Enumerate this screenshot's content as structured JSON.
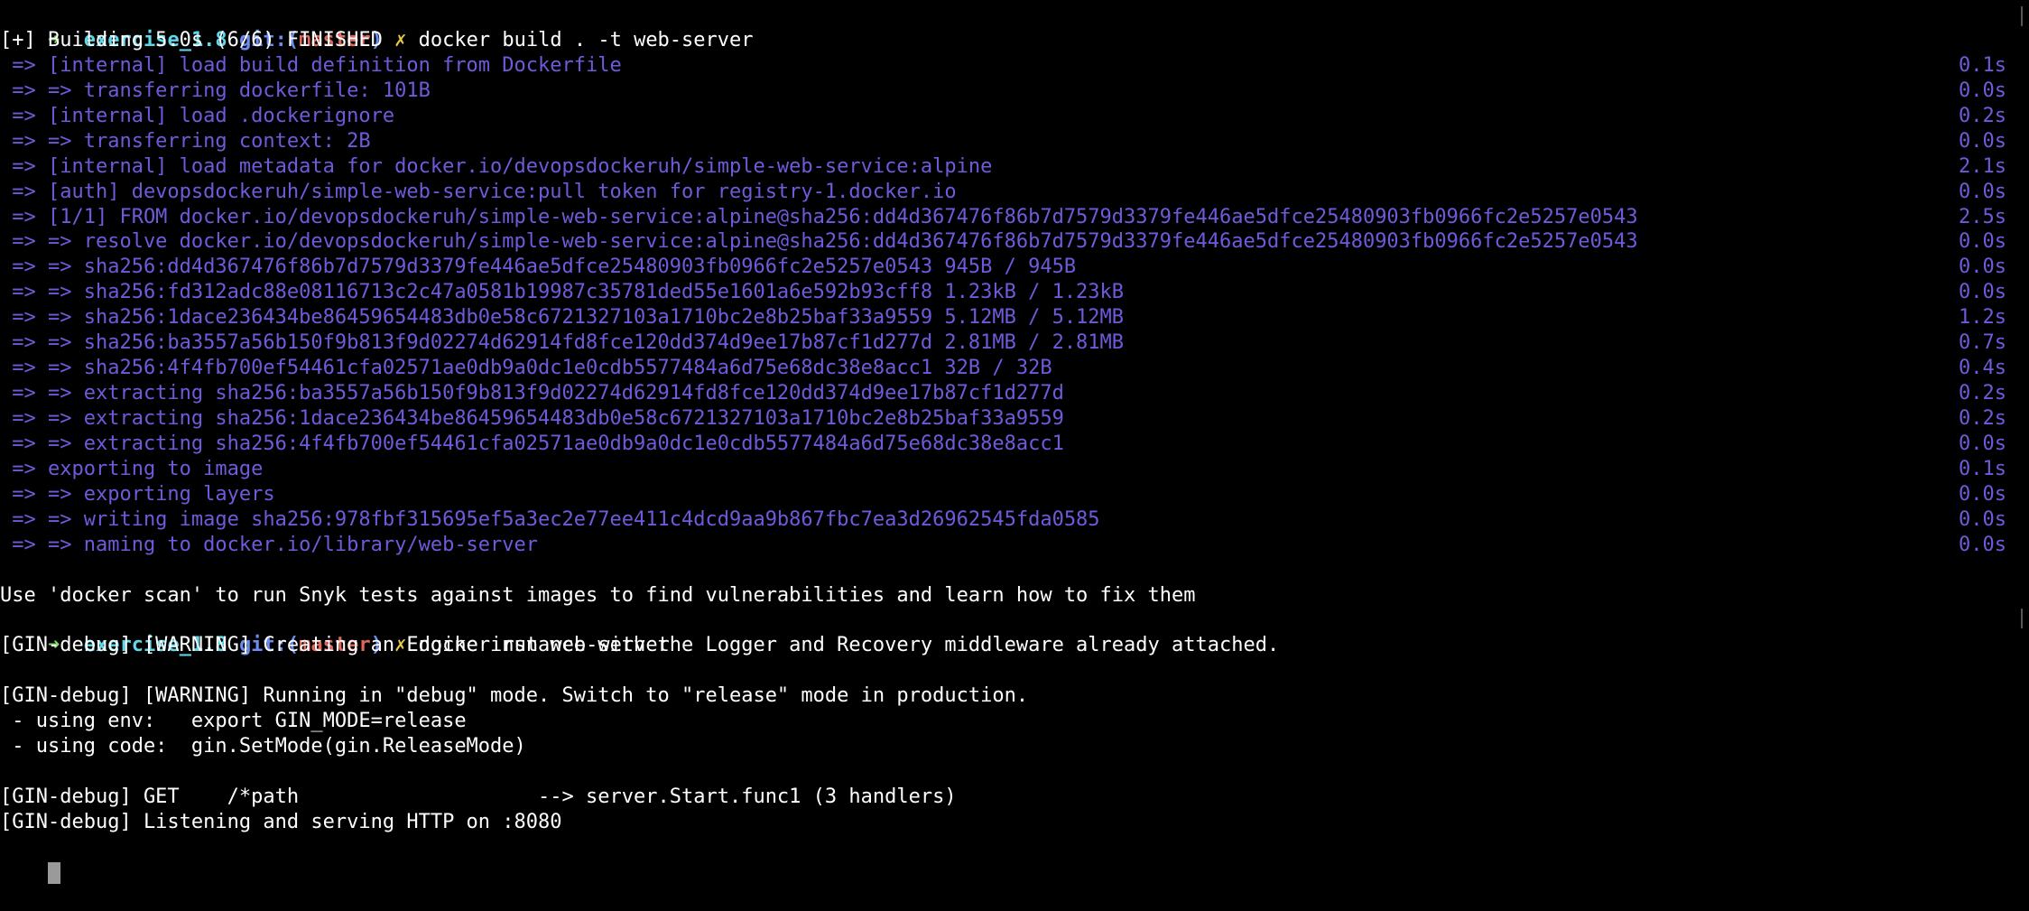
{
  "colors": {
    "background": "#000000",
    "build_output": "#6e5bdc",
    "prompt_arrow": "#7fd962",
    "prompt_dir": "#5fd7e8",
    "prompt_git": "#6b8cf0",
    "prompt_branch": "#e0675c",
    "prompt_dirty": "#e6c84a"
  },
  "prompt1": {
    "arrow": "➜",
    "dir": "exercise_1.8",
    "git": "git:(",
    "branch": "master",
    "git_close": ")",
    "dirty": "✗",
    "command": "docker build . -t web-server"
  },
  "build": {
    "header": "[+] Building 5.0s (6/6) FINISHED",
    "steps": [
      {
        "text": " => [internal] load build definition from Dockerfile",
        "time": "0.1s"
      },
      {
        "text": " => => transferring dockerfile: 101B",
        "time": "0.0s"
      },
      {
        "text": " => [internal] load .dockerignore",
        "time": "0.2s"
      },
      {
        "text": " => => transferring context: 2B",
        "time": "0.0s"
      },
      {
        "text": " => [internal] load metadata for docker.io/devopsdockeruh/simple-web-service:alpine",
        "time": "2.1s"
      },
      {
        "text": " => [auth] devopsdockeruh/simple-web-service:pull token for registry-1.docker.io",
        "time": "0.0s"
      },
      {
        "text": " => [1/1] FROM docker.io/devopsdockeruh/simple-web-service:alpine@sha256:dd4d367476f86b7d7579d3379fe446ae5dfce25480903fb0966fc2e5257e0543",
        "time": "2.5s"
      },
      {
        "text": " => => resolve docker.io/devopsdockeruh/simple-web-service:alpine@sha256:dd4d367476f86b7d7579d3379fe446ae5dfce25480903fb0966fc2e5257e0543",
        "time": "0.0s"
      },
      {
        "text": " => => sha256:dd4d367476f86b7d7579d3379fe446ae5dfce25480903fb0966fc2e5257e0543 945B / 945B",
        "time": "0.0s"
      },
      {
        "text": " => => sha256:fd312adc88e08116713c2c47a0581b19987c35781ded55e1601a6e592b93cff8 1.23kB / 1.23kB",
        "time": "0.0s"
      },
      {
        "text": " => => sha256:1dace236434be86459654483db0e58c6721327103a1710bc2e8b25baf33a9559 5.12MB / 5.12MB",
        "time": "1.2s"
      },
      {
        "text": " => => sha256:ba3557a56b150f9b813f9d02274d62914fd8fce120dd374d9ee17b87cf1d277d 2.81MB / 2.81MB",
        "time": "0.7s"
      },
      {
        "text": " => => sha256:4f4fb700ef54461cfa02571ae0db9a0dc1e0cdb5577484a6d75e68dc38e8acc1 32B / 32B",
        "time": "0.4s"
      },
      {
        "text": " => => extracting sha256:ba3557a56b150f9b813f9d02274d62914fd8fce120dd374d9ee17b87cf1d277d",
        "time": "0.2s"
      },
      {
        "text": " => => extracting sha256:1dace236434be86459654483db0e58c6721327103a1710bc2e8b25baf33a9559",
        "time": "0.2s"
      },
      {
        "text": " => => extracting sha256:4f4fb700ef54461cfa02571ae0db9a0dc1e0cdb5577484a6d75e68dc38e8acc1",
        "time": "0.0s"
      },
      {
        "text": " => exporting to image",
        "time": "0.1s"
      },
      {
        "text": " => => exporting layers",
        "time": "0.0s"
      },
      {
        "text": " => => writing image sha256:978fbf315695ef5a3ec2e77ee411c4dcd9aa9b867fbc7ea3d26962545fda0585",
        "time": "0.0s"
      },
      {
        "text": " => => naming to docker.io/library/web-server",
        "time": "0.0s"
      }
    ],
    "scan_hint": "Use 'docker scan' to run Snyk tests against images to find vulnerabilities and learn how to fix them"
  },
  "prompt2": {
    "arrow": "➜",
    "dir": "exercise_1.8",
    "git": "git:(",
    "branch": "master",
    "git_close": ")",
    "dirty": "✗",
    "command": "docker run web-server"
  },
  "run_output": {
    "line1": "[GIN-debug] [WARNING] Creating an Engine instance with the Logger and Recovery middleware already attached.",
    "line2": "[GIN-debug] [WARNING] Running in \"debug\" mode. Switch to \"release\" mode in production.",
    "line3": " - using env:   export GIN_MODE=release",
    "line4": " - using code:  gin.SetMode(gin.ReleaseMode)",
    "line5": "[GIN-debug] GET    /*path                    --> server.Start.func1 (3 handlers)",
    "line6": "[GIN-debug] Listening and serving HTTP on :8080"
  }
}
